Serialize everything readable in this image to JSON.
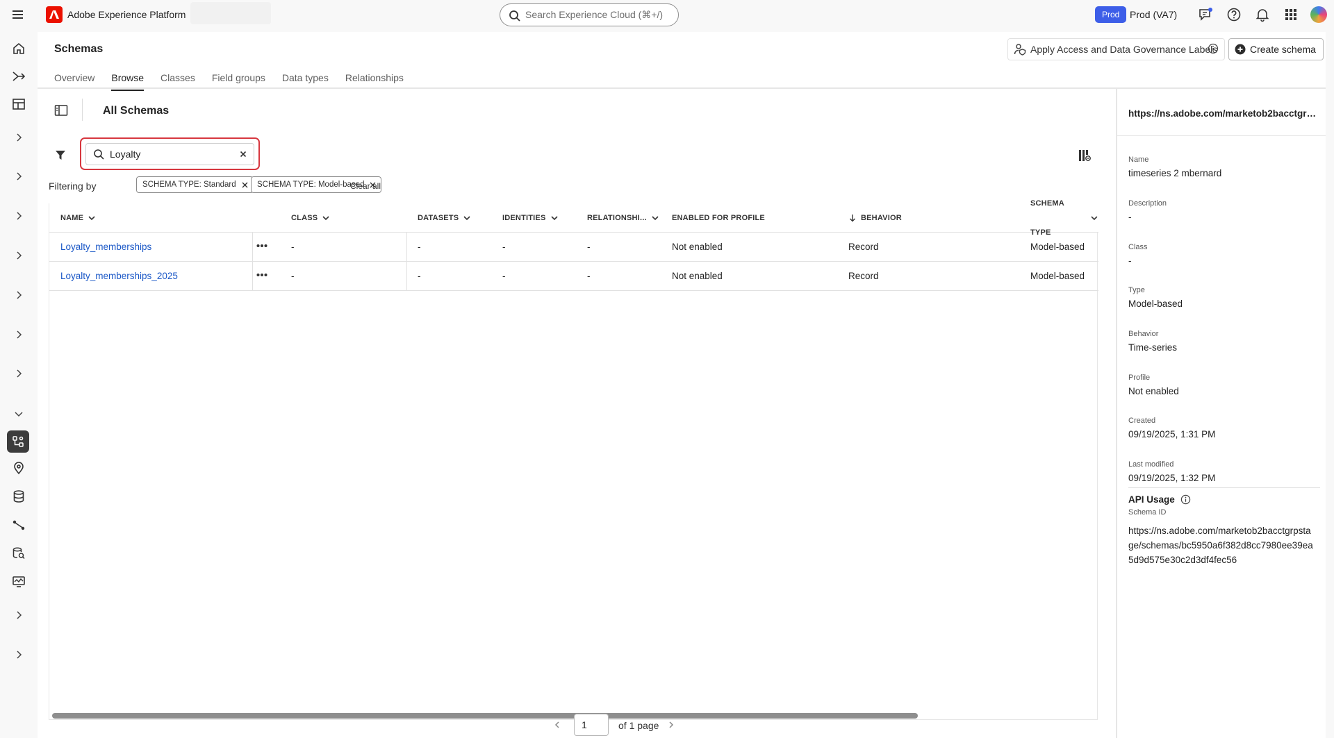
{
  "topbar": {
    "app_title": "Adobe Experience Platform",
    "search_placeholder": "Search Experience Cloud (⌘+/)",
    "env_badge": "Prod",
    "env_label": "Prod (VA7)"
  },
  "header": {
    "page_title": "Schemas",
    "apply_labels_button": "Apply Access and Data Governance Labels",
    "create_button": "Create schema"
  },
  "tabs": [
    {
      "label": "Overview",
      "active": false
    },
    {
      "label": "Browse",
      "active": true
    },
    {
      "label": "Classes",
      "active": false
    },
    {
      "label": "Field groups",
      "active": false
    },
    {
      "label": "Data types",
      "active": false
    },
    {
      "label": "Relationships",
      "active": false
    }
  ],
  "browse": {
    "section_title": "All Schemas",
    "search_value": "Loyalty",
    "filtering_by_label": "Filtering by",
    "chips": [
      "SCHEMA TYPE: Standard",
      "SCHEMA TYPE: Model-based"
    ],
    "clear_all": "Clear all"
  },
  "table": {
    "columns": [
      "NAME",
      "CLASS",
      "DATASETS",
      "IDENTITIES",
      "RELATIONSHI...",
      "ENABLED FOR PROFILE",
      "BEHAVIOR",
      "SCHEMA TYPE"
    ],
    "rows": [
      {
        "name": "Loyalty_memberships",
        "class": "-",
        "datasets": "-",
        "identities": "-",
        "relationships": "-",
        "profile": "Not enabled",
        "behavior": "Record",
        "schema_type": "Model-based"
      },
      {
        "name": "Loyalty_memberships_2025",
        "class": "-",
        "datasets": "-",
        "identities": "-",
        "relationships": "-",
        "profile": "Not enabled",
        "behavior": "Record",
        "schema_type": "Model-based"
      }
    ]
  },
  "pager": {
    "current_page": "1",
    "of_text": "of 1 page"
  },
  "detail": {
    "url_title": "https://ns.adobe.com/marketob2bacctgrpstage/schemas/bc5950a6f382d8cc7980ee39ea5d9d575e30c2d3df4fec56",
    "name_label": "Name",
    "name_value": "timeseries 2 mbernard",
    "description_label": "Description",
    "description_value": "-",
    "class_label": "Class",
    "class_value": "-",
    "type_label": "Type",
    "type_value": "Model-based",
    "behavior_label": "Behavior",
    "behavior_value": "Time-series",
    "profile_label": "Profile",
    "profile_value": "Not enabled",
    "created_label": "Created",
    "created_value": "09/19/2025, 1:31 PM",
    "modified_label": "Last modified",
    "modified_value": "09/19/2025, 1:32 PM",
    "api_usage_title": "API Usage",
    "schema_id_label": "Schema ID",
    "schema_id_value": "https://ns.adobe.com/marketob2bacctgrpstage/schemas/bc5950a6f382d8cc7980ee39ea5d9d575e30c2d3df4fec56"
  },
  "colors": {
    "accent": "#3d5ee8",
    "link": "#1b58c7",
    "highlight": "#d7373f",
    "adobe_red": "#eb1000"
  }
}
